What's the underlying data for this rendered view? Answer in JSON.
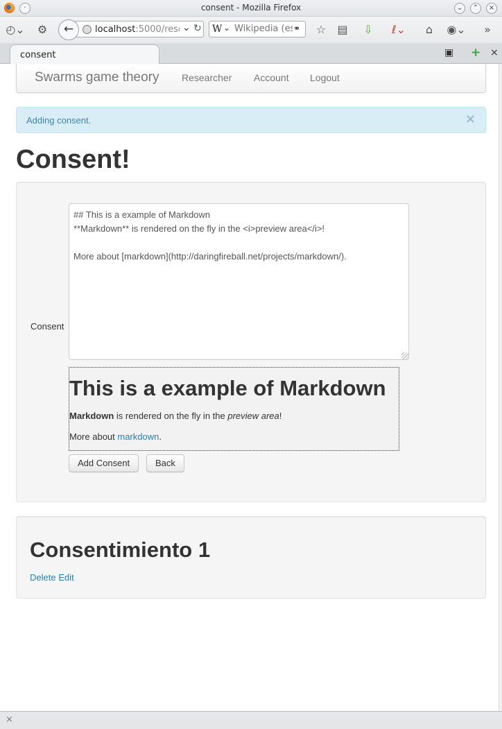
{
  "window": {
    "title": "consent - Mozilla Firefox"
  },
  "browser": {
    "url_host": "localhost",
    "url_rest": ":5000/rese",
    "search_engine": "W",
    "search_placeholder": "Wikipedia (es",
    "tab_label": "consent"
  },
  "app": {
    "brand": "Swarms game theory",
    "nav": [
      "Researcher",
      "Account",
      "Logout"
    ]
  },
  "alert": {
    "text": "Adding consent.",
    "close": "×"
  },
  "page": {
    "title": "Consent!"
  },
  "form": {
    "label": "Consent",
    "editor_text": "## This is a example of Markdown\n**Markdown** is rendered on the fly in the <i>preview area</i>!\n\nMore about [markdown](http://daringfireball.net/projects/markdown/).",
    "preview": {
      "heading": "This is a example of Markdown",
      "p1_bold": "Markdown",
      "p1_mid": " is rendered on the fly in the ",
      "p1_em": "preview area",
      "p1_end": "!",
      "p2_start": "More about ",
      "p2_link": "markdown",
      "p2_end": "."
    },
    "add_button": "Add Consent",
    "back_button": "Back"
  },
  "consents": {
    "title": "Consentimiento 1",
    "delete_link": "Delete",
    "edit_link": "Edit"
  },
  "statusbar": {
    "close": "×"
  }
}
